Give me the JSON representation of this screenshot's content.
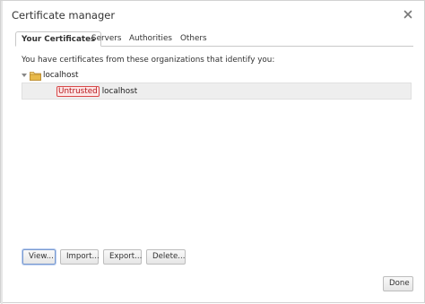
{
  "dialog": {
    "title": "Certificate manager",
    "close_icon": "close-icon"
  },
  "tabs": [
    {
      "label": "Your Certificates",
      "active": true
    },
    {
      "label": "Servers",
      "active": false
    },
    {
      "label": "Authorities",
      "active": false
    },
    {
      "label": "Others",
      "active": false
    }
  ],
  "panel": {
    "description": "You have certificates from these organizations that identify you:",
    "group": {
      "expander_icon": "expand-triangle-icon",
      "folder_icon": "folder-icon",
      "label": "localhost",
      "certificates": [
        {
          "badge": "Untrusted",
          "name": "localhost"
        }
      ]
    }
  },
  "actions": {
    "view": "View...",
    "import": "Import...",
    "export": "Export...",
    "delete": "Delete..."
  },
  "footer": {
    "done": "Done"
  },
  "colors": {
    "badge_text": "#b5171b",
    "badge_border": "#d94a4a",
    "badge_bg": "#fde7e7",
    "row_bg": "#eeeeee",
    "folder": "#e8b94a"
  }
}
